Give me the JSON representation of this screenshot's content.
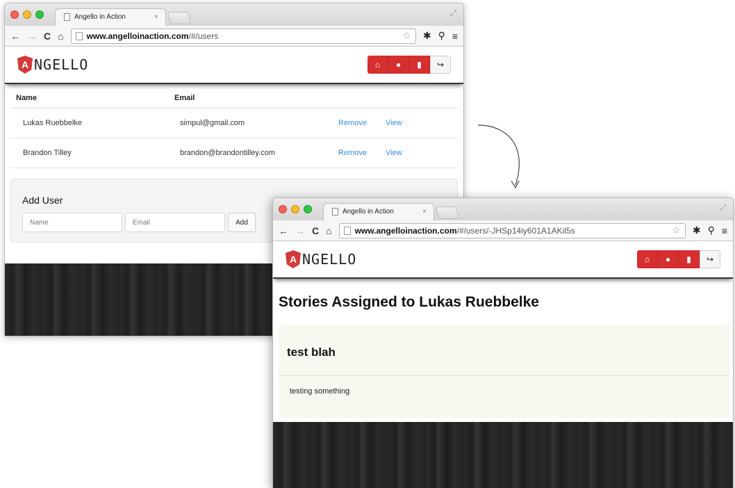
{
  "window1": {
    "tab_title": "Angello in Action",
    "tab_close": "×",
    "url_host": "www.angelloinaction.com",
    "url_path": "/#/users",
    "logo_letter": "A",
    "logo_text": "NGELLO",
    "table": {
      "headers": [
        "Name",
        "Email"
      ],
      "rows": [
        {
          "name": "Lukas Ruebbelke",
          "email": "simpul@gmail.com",
          "remove": "Remove",
          "view": "View"
        },
        {
          "name": "Brandon Tilley",
          "email": "brandon@brandontilley.com",
          "remove": "Remove",
          "view": "View"
        }
      ]
    },
    "add_user": {
      "title": "Add User",
      "name_placeholder": "Name",
      "email_placeholder": "Email",
      "add_label": "Add"
    }
  },
  "window2": {
    "tab_title": "Angello in Action",
    "tab_close": "×",
    "url_host": "www.angelloinaction.com",
    "url_path": "/#/users/-JHSp14iy601A1AKil5s",
    "logo_letter": "A",
    "logo_text": "NGELLO",
    "page_title": "Stories Assigned to Lukas Ruebbelke",
    "story": {
      "title": "test blah",
      "description": "testing something"
    }
  },
  "icons": {
    "back": "←",
    "forward": "→",
    "reload": "C",
    "home": "⌂",
    "star": "☆",
    "settings": "✱",
    "wrench": "⚲",
    "menu": "≡",
    "header_home": "⌂",
    "header_user": "●",
    "header_stats": "▮",
    "header_logout": "↪"
  },
  "colors": {
    "brand_red": "#d62f2f",
    "link_blue": "#3a8dd8",
    "story_bg": "#f8f7f0"
  }
}
